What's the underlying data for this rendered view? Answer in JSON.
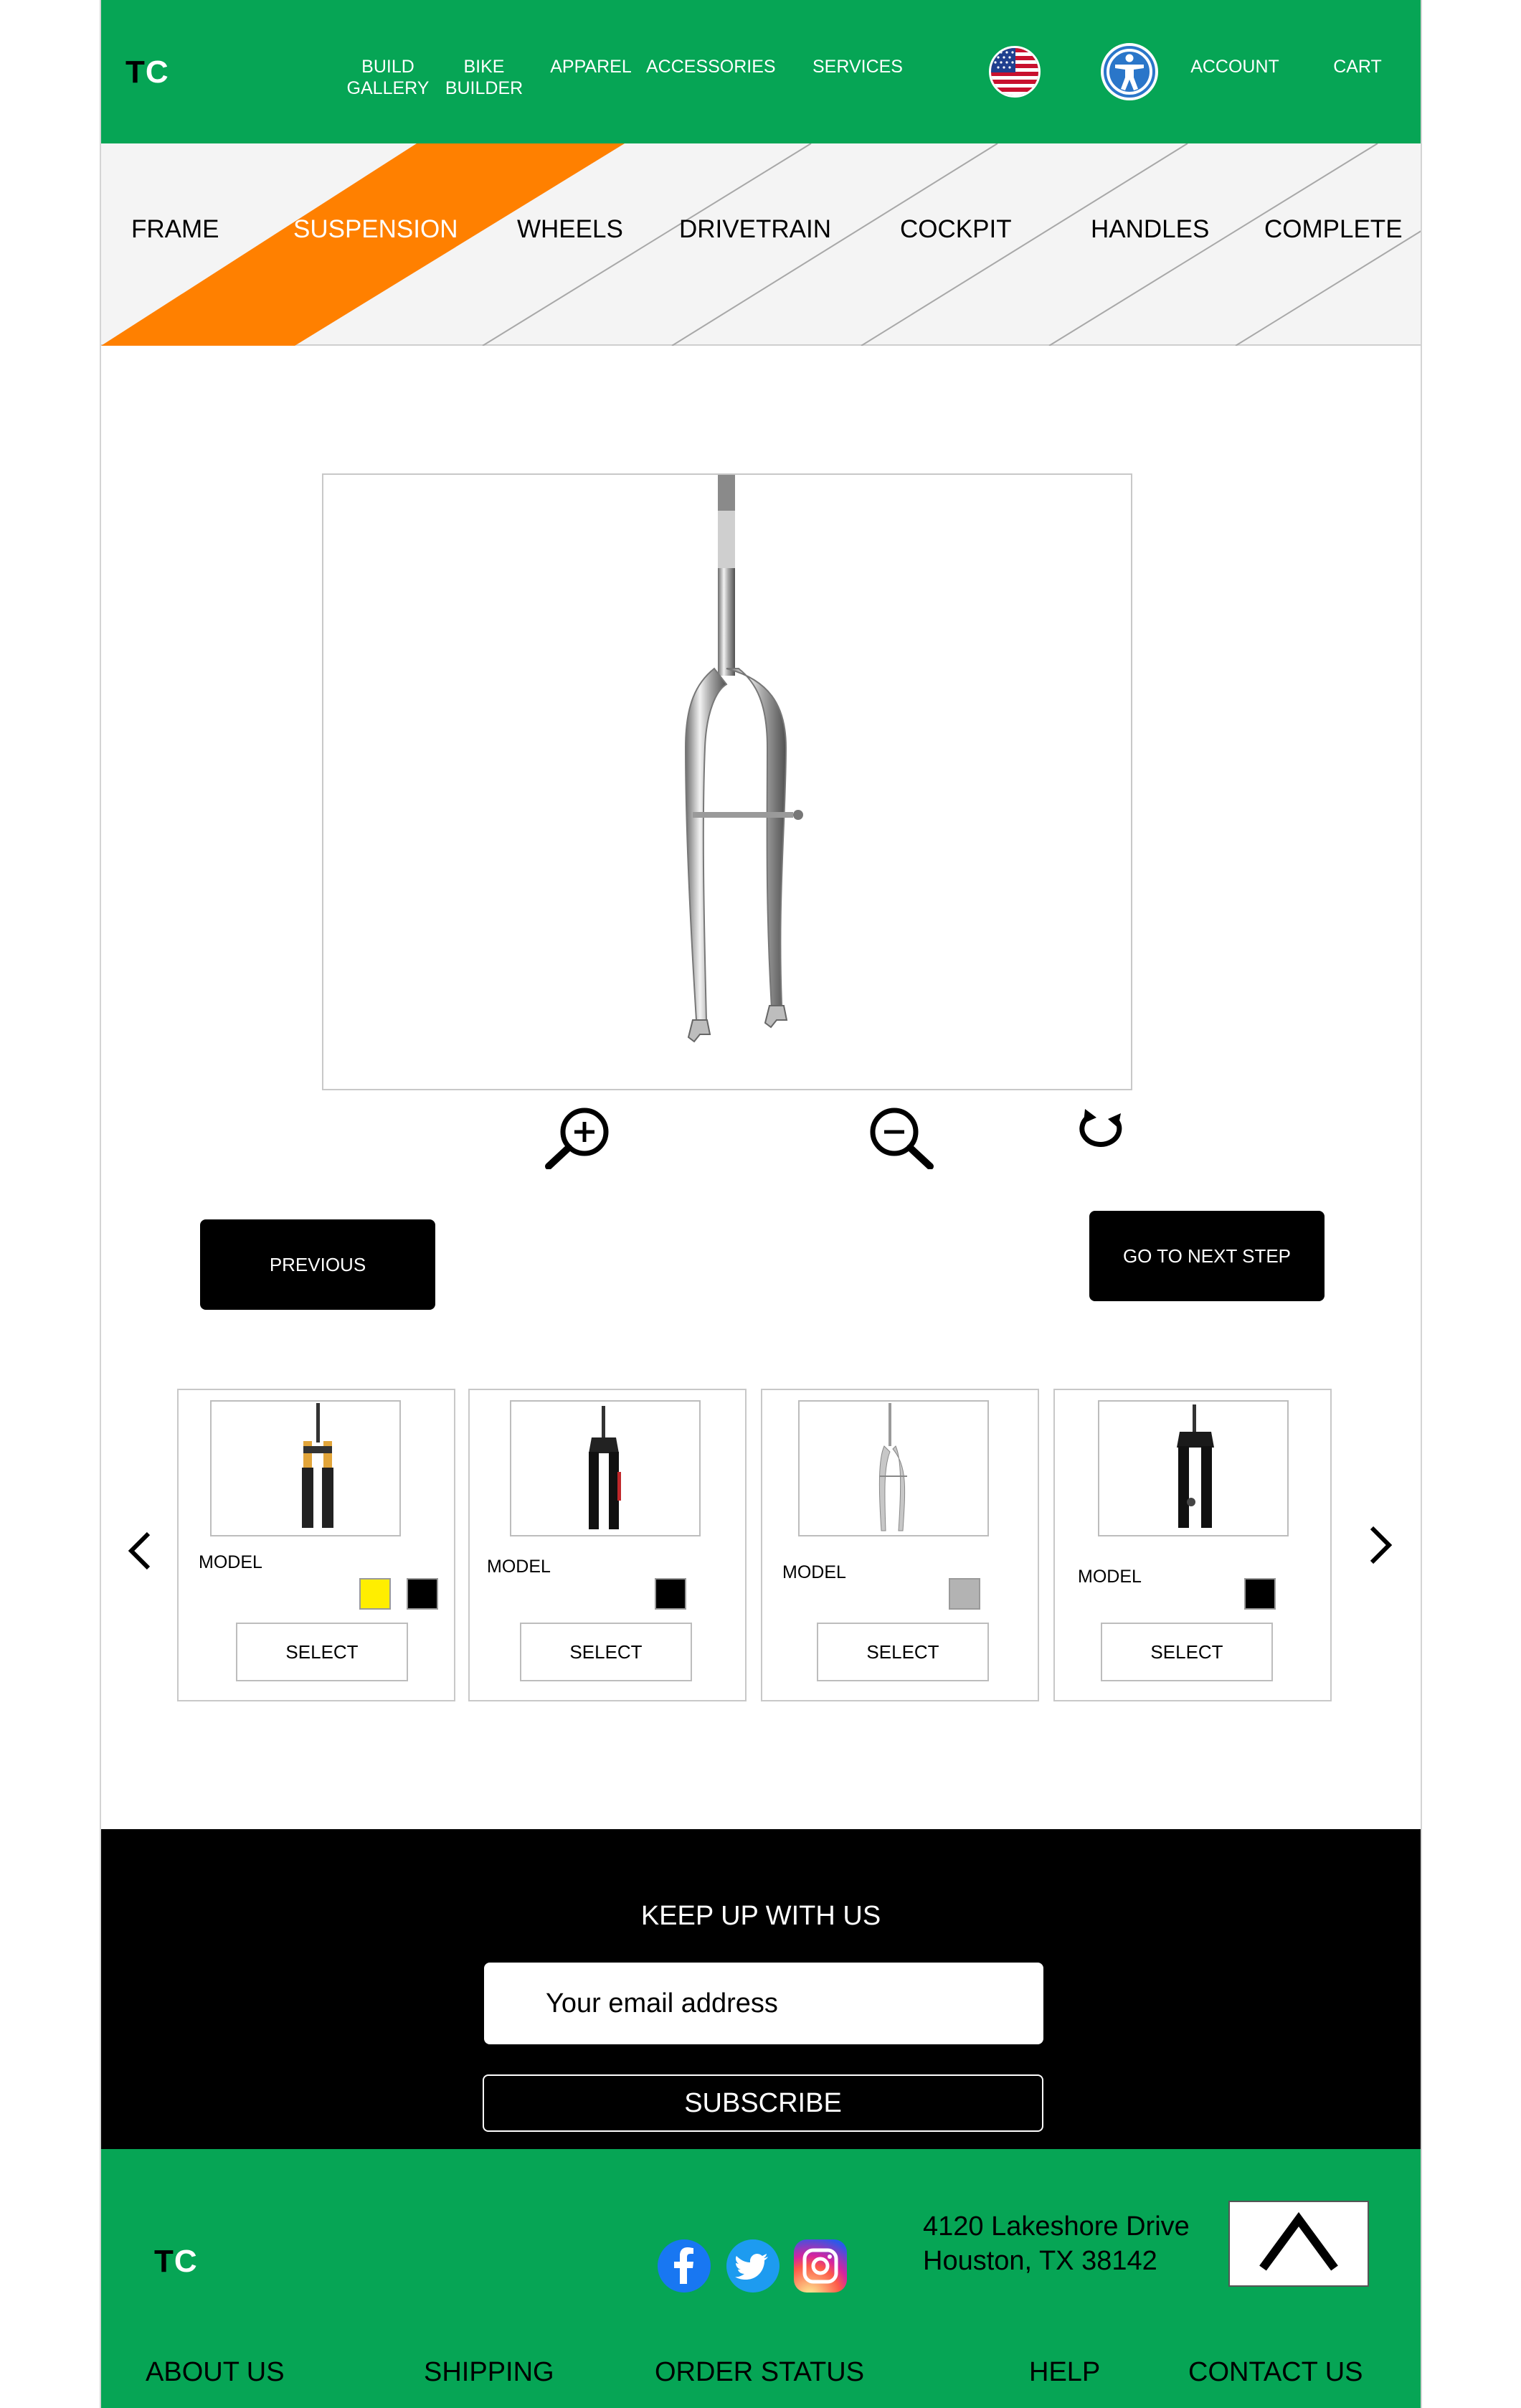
{
  "header": {
    "logo_t": "T",
    "logo_c": "C",
    "nav": [
      {
        "label": "BUILD\nGALLERY"
      },
      {
        "label": "BIKE\nBUILDER"
      },
      {
        "label": "APPAREL"
      },
      {
        "label": "ACCESSORIES"
      },
      {
        "label": "SERVICES"
      },
      {
        "label": "ACCOUNT"
      },
      {
        "label": "CART"
      }
    ],
    "flag_icon": "us-flag-icon",
    "accessibility_icon": "accessibility-icon"
  },
  "steps": {
    "items": [
      "FRAME",
      "SUSPENSION",
      "WHEELS",
      "DRIVETRAIN",
      "COCKPIT",
      "HANDLES",
      "COMPLETE"
    ],
    "active": "SUSPENSION",
    "active_color": "#ff8000"
  },
  "viewer": {
    "tools": [
      "zoom-in-icon",
      "zoom-out-icon",
      "rotate-icon"
    ]
  },
  "buttons": {
    "previous": "PREVIOUS",
    "next": "GO TO NEXT STEP"
  },
  "carousel": {
    "products": [
      {
        "model": "MODEL",
        "swatches": [
          "#ffee00",
          "#000000"
        ],
        "select": "SELECT"
      },
      {
        "model": "MODEL",
        "swatches": [
          "#000000"
        ],
        "select": "SELECT"
      },
      {
        "model": "MODEL",
        "swatches": [
          "#b3b3b3"
        ],
        "select": "SELECT"
      },
      {
        "model": "MODEL",
        "swatches": [
          "#000000"
        ],
        "select": "SELECT"
      }
    ]
  },
  "newsletter": {
    "title": "KEEP UP WITH US",
    "email_placeholder": "Your email address",
    "subscribe": "SUBSCRIBE"
  },
  "footer": {
    "logo_t": "T",
    "logo_c": "C",
    "social": [
      "facebook-icon",
      "twitter-icon",
      "instagram-icon"
    ],
    "address_line1": "4120 Lakeshore Drive",
    "address_line2": "Houston, TX 38142",
    "links": [
      "ABOUT US",
      "SHIPPING",
      "ORDER STATUS",
      "HELP",
      "CONTACT US"
    ]
  },
  "colors": {
    "brand_green": "#06a555",
    "accent_orange": "#ff8000"
  }
}
